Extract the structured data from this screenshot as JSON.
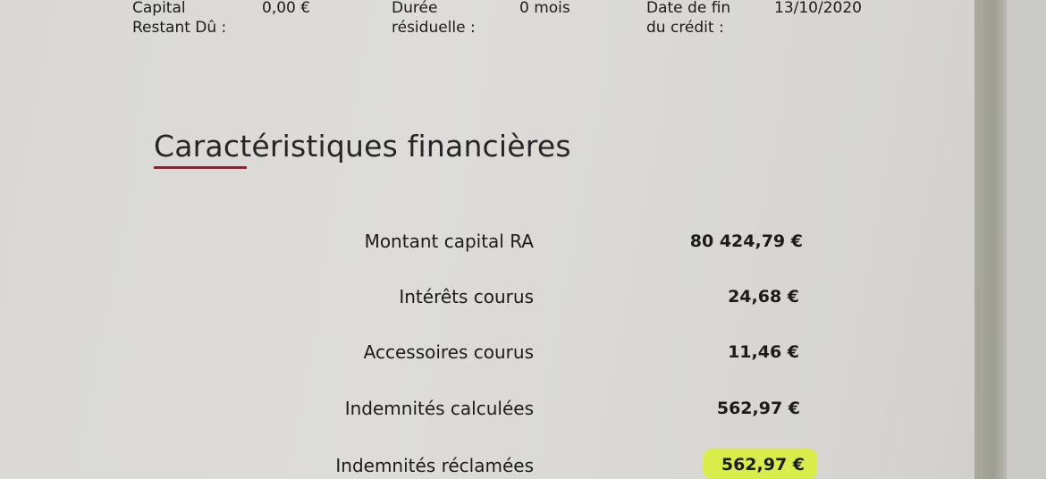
{
  "header": {
    "capital_label_line1": "Capital",
    "capital_label_line2": "Restant Dû :",
    "capital_value": "0,00 €",
    "duree_label_line1": "Durée",
    "duree_label_line2": "résiduelle :",
    "duree_value": "0 mois",
    "date_label_line1": "Date de fin",
    "date_label_line2": "du crédit :",
    "date_value": "13/10/2020"
  },
  "section": {
    "title": "Caractéristiques financières"
  },
  "rows": [
    {
      "label": "Montant capital RA",
      "value": "80 424,79 €"
    },
    {
      "label": "Intérêts courus",
      "value": "24,68 €"
    },
    {
      "label": "Accessoires courus",
      "value": "11,46 €"
    },
    {
      "label": "Indemnités calculées",
      "value": "562,97 €"
    },
    {
      "label": "Indemnités réclamées",
      "value": "562,97 €"
    }
  ],
  "colors": {
    "accent_underline": "#7d2a33",
    "highlighter": "#d8f03a"
  }
}
